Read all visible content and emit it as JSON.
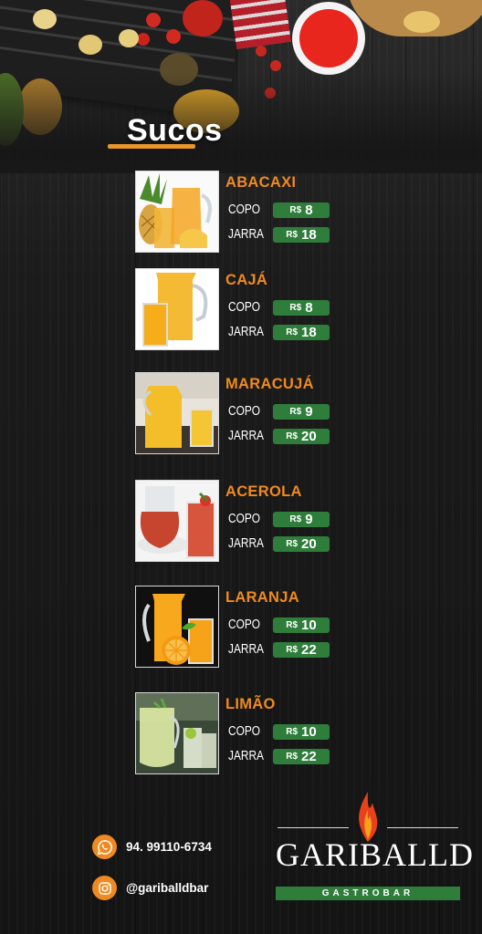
{
  "menu": {
    "title": "Sucos",
    "size_labels": {
      "small": "COPO",
      "large": "JARRA"
    },
    "currency": "R$",
    "items": [
      {
        "name": "ABACAXI",
        "copo": "8",
        "jarra": "18"
      },
      {
        "name": "CAJÁ",
        "copo": "8",
        "jarra": "18"
      },
      {
        "name": "MARACUJÁ",
        "copo": "9",
        "jarra": "20"
      },
      {
        "name": "ACEROLA",
        "copo": "9",
        "jarra": "20"
      },
      {
        "name": "LARANJA",
        "copo": "10",
        "jarra": "22"
      },
      {
        "name": "LIMÃO",
        "copo": "10",
        "jarra": "22"
      }
    ]
  },
  "contact": {
    "phone": "94. 99110-6734",
    "instagram": "@gariballdbar",
    "icons": [
      "whatsapp-icon",
      "instagram-icon"
    ]
  },
  "brand": {
    "name": "GARIBALLD",
    "subtitle": "GASTROBAR"
  },
  "colors": {
    "accent": "#ef8a22",
    "price_bg": "#2f7d3b",
    "background": "#151515"
  }
}
